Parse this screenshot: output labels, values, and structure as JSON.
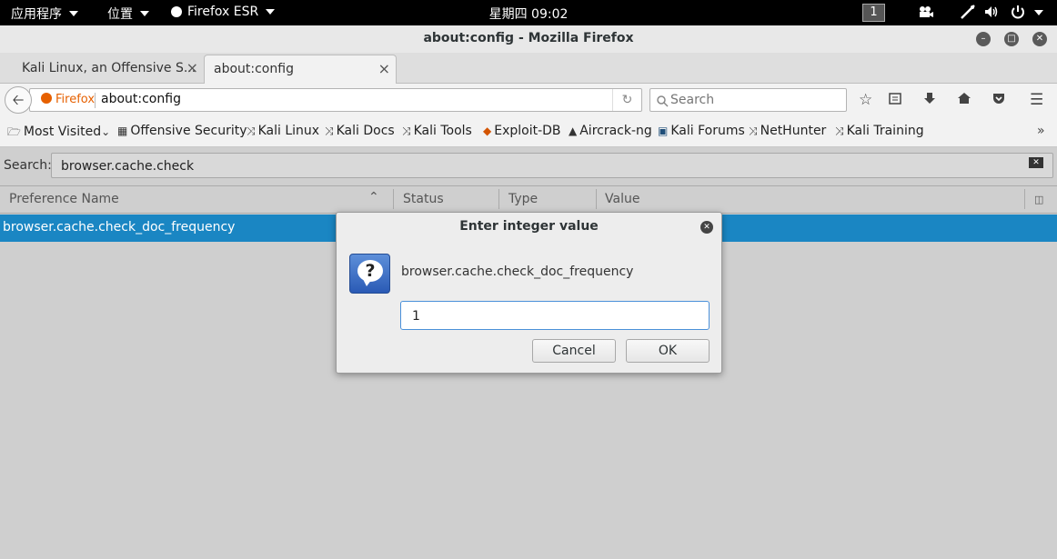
{
  "topbar": {
    "apps_menu": "应用程序",
    "places_menu": "位置",
    "app_menu": "Firefox ESR",
    "clock": "星期四 09:02",
    "workspace": "1"
  },
  "window": {
    "title": "about:config - Mozilla Firefox"
  },
  "tabs": [
    {
      "label": "Kali Linux, an Offensive S..."
    },
    {
      "label": "about:config"
    }
  ],
  "navbar": {
    "identity_label": "Firefox",
    "url": "about:config",
    "search_placeholder": "Search"
  },
  "bookmarks": [
    {
      "label": "Most Visited"
    },
    {
      "label": "Offensive Security"
    },
    {
      "label": "Kali Linux"
    },
    {
      "label": "Kali Docs"
    },
    {
      "label": "Kali Tools"
    },
    {
      "label": "Exploit-DB"
    },
    {
      "label": "Aircrack-ng"
    },
    {
      "label": "Kali Forums"
    },
    {
      "label": "NetHunter"
    },
    {
      "label": "Kali Training"
    }
  ],
  "config": {
    "search_label": "Search:",
    "search_value": "browser.cache.check",
    "columns": [
      "Preference Name",
      "Status",
      "Type",
      "Value"
    ],
    "rows": [
      {
        "name": "browser.cache.check_doc_frequency",
        "status": "",
        "type": "",
        "value": ""
      }
    ]
  },
  "dialog": {
    "title": "Enter integer value",
    "message": "browser.cache.check_doc_frequency",
    "input_value": "1",
    "cancel_label": "Cancel",
    "ok_label": "OK"
  },
  "colors": {
    "selection": "#1a86c3",
    "firefox_orange": "#e66000",
    "topbar": "#000000"
  }
}
